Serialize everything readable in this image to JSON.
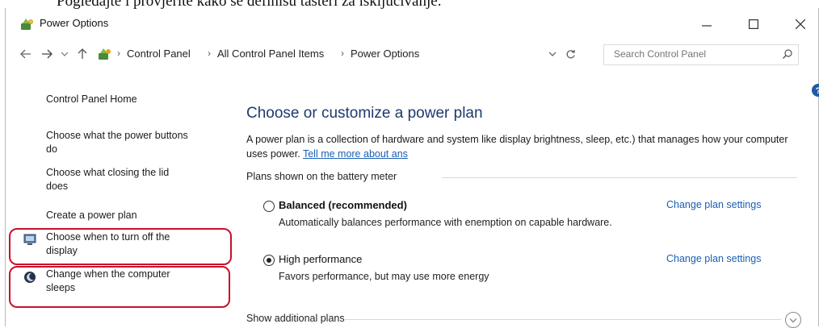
{
  "caption": "Pogledajte i provjerite kako se definisu tasteri za isključivanje.",
  "window": {
    "title": "Power Options"
  },
  "address": {
    "crumbs": [
      "Control Panel",
      "All Control Panel Items",
      "Power Options"
    ],
    "search_placeholder": "Search Control Panel"
  },
  "sidebar": {
    "home": "Control Panel Home",
    "links": [
      "Choose what the power buttons do",
      "Choose what closing the lid does",
      "Create a power plan",
      "Choose when to turn off the display",
      "Change when the computer sleeps"
    ]
  },
  "main": {
    "heading": "Choose or customize a power plan",
    "description": "A power plan is a collection of hardware and system like display brightness, sleep, etc.) that manages how your computer uses power.",
    "tell_more": "Tell me more about ans",
    "plans_section": "Plans shown on the battery meter",
    "plans": [
      {
        "name": "Balanced (recommended)",
        "desc": "Automatically balances performance with enemption on capable hardware.",
        "link": "Change plan settings",
        "selected": false
      },
      {
        "name": "High performance",
        "desc": "Favors performance, but may use more energy",
        "link": "Change plan settings",
        "selected": true
      }
    ],
    "additional": "Show additional plans"
  }
}
